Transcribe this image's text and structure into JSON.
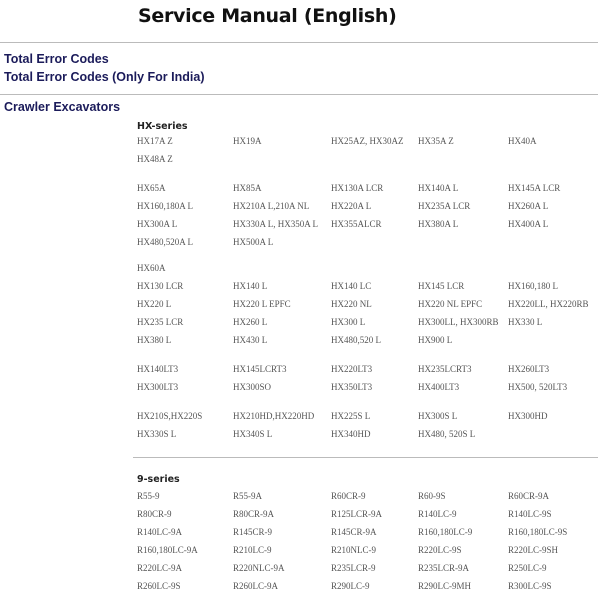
{
  "title": "Service Manual (English)",
  "links": [
    "Total Error Codes",
    "Total Error Codes (Only For India)"
  ],
  "section": "Crawler Excavators",
  "series": [
    {
      "name": "HX-series",
      "groups": [
        [
          [
            "HX17A Z",
            "HX19A",
            "HX25AZ, HX30AZ",
            "HX35A Z",
            "HX40A"
          ],
          [
            "HX48A Z"
          ]
        ],
        [
          [
            "HX65A",
            "HX85A",
            "HX130A LCR",
            "HX140A L",
            "HX145A LCR"
          ],
          [
            "HX160,180A L",
            "HX210A L,210A NL",
            "HX220A L",
            "HX235A LCR",
            "HX260A L"
          ],
          [
            "HX300A L",
            "HX330A L, HX350A L",
            "HX355ALCR",
            "HX380A L",
            "HX400A L"
          ],
          [
            "HX480,520A L",
            "HX500A L"
          ]
        ],
        [
          [
            "HX60A"
          ],
          [
            "HX130 LCR",
            "HX140 L",
            "HX140 LC",
            "HX145 LCR",
            "HX160,180 L"
          ],
          [
            "HX220 L",
            "HX220 L EPFC",
            "HX220 NL",
            "HX220 NL EPFC",
            "HX220LL, HX220RB"
          ],
          [
            "HX235 LCR",
            "HX260 L",
            "HX300 L",
            "HX300LL, HX300RB",
            "HX330 L"
          ],
          [
            "HX380 L",
            "HX430 L",
            "HX480,520 L",
            "HX900 L"
          ]
        ],
        [
          [
            "HX140LT3",
            "HX145LCRT3",
            "HX220LT3",
            "HX235LCRT3",
            "HX260LT3"
          ],
          [
            "HX300LT3",
            "HX300SO",
            "HX350LT3",
            "HX400LT3",
            "HX500, 520LT3"
          ]
        ],
        [
          [
            "HX210S,HX220S",
            "HX210HD,HX220HD",
            "HX225S L",
            "HX300S L",
            "HX300HD"
          ],
          [
            "HX330S L",
            "HX340S L",
            "HX340HD",
            "HX480, 520S L"
          ]
        ]
      ]
    },
    {
      "name": "9-series",
      "groups": [
        [
          [
            "R55-9",
            "R55-9A",
            "R60CR-9",
            "R60-9S",
            "R60CR-9A"
          ],
          [
            "R80CR-9",
            "R80CR-9A",
            "R125LCR-9A",
            "R140LC-9",
            "R140LC-9S"
          ],
          [
            "R140LC-9A",
            "R145CR-9",
            "R145CR-9A",
            "R160,180LC-9",
            "R160,180LC-9S"
          ],
          [
            "R160,180LC-9A",
            "R210LC-9",
            "R210NLC-9",
            "R220LC-9S",
            "R220LC-9SH"
          ],
          [
            "R220LC-9A",
            "R220NLC-9A",
            "R235LCR-9",
            "R235LCR-9A",
            "R250LC-9"
          ],
          [
            "R260LC-9S",
            "R260LC-9A",
            "R290LC-9",
            "R290LC-9MH",
            "R300LC-9S"
          ]
        ]
      ]
    }
  ]
}
